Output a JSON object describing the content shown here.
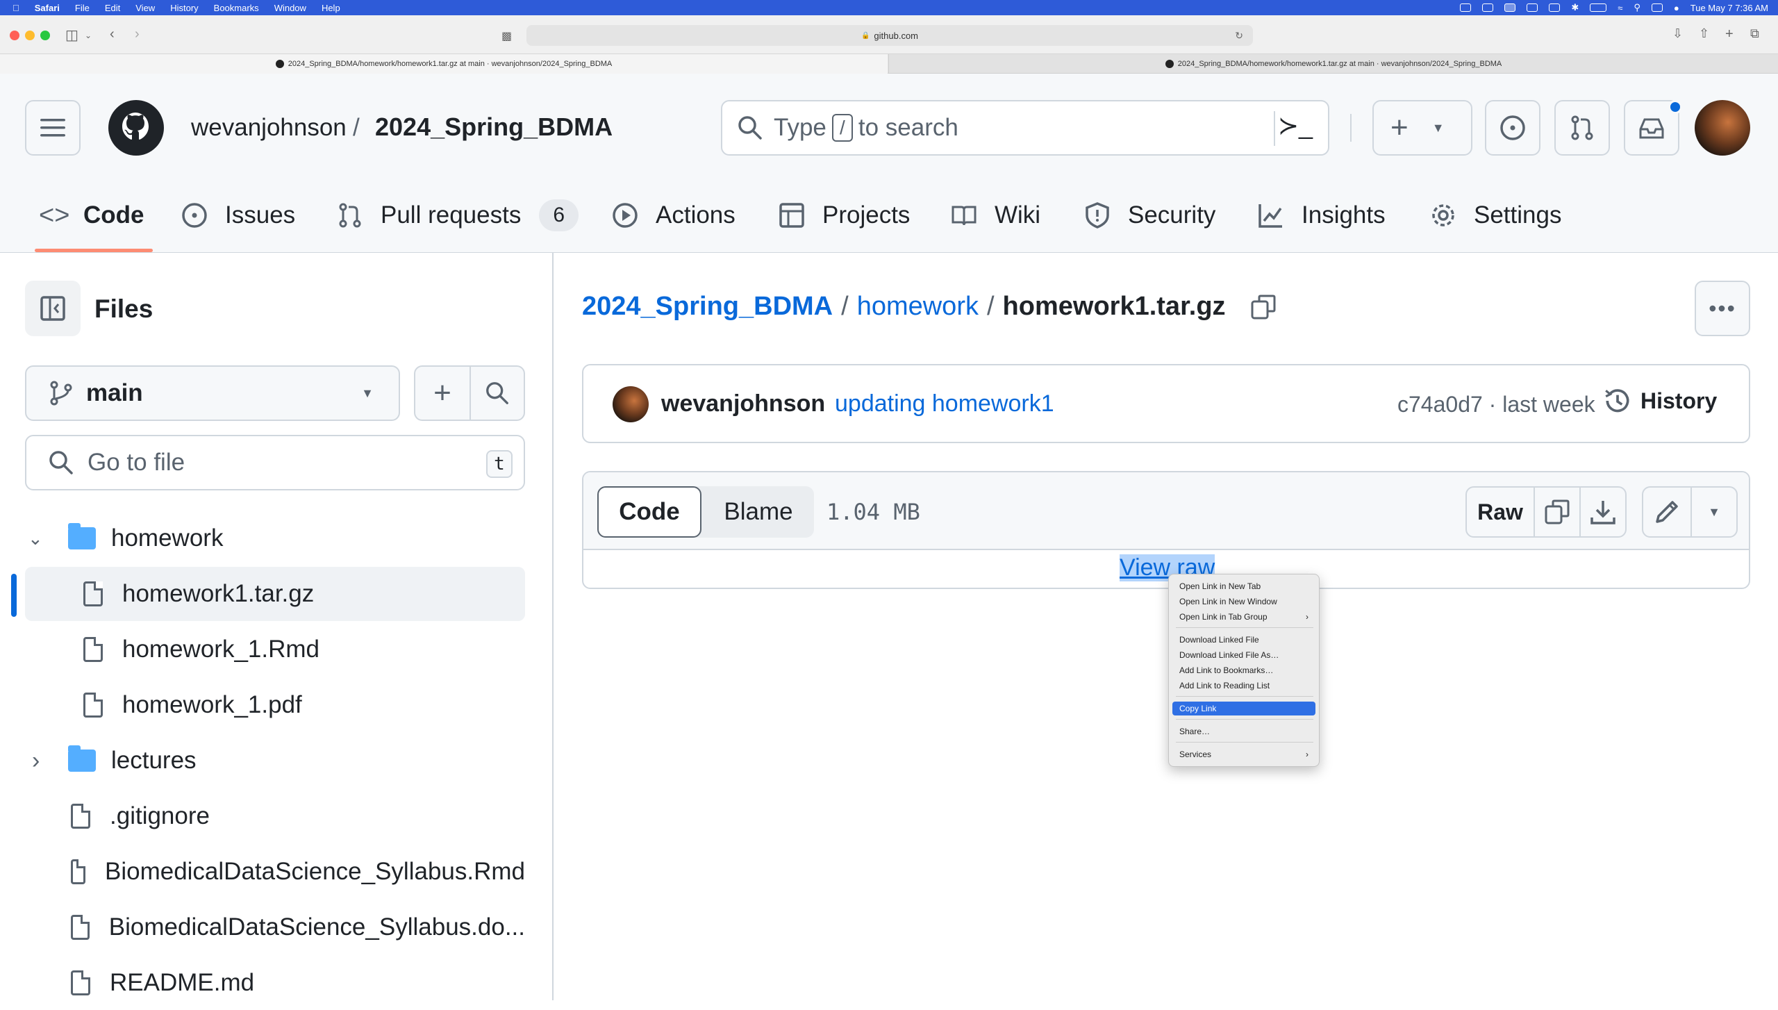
{
  "menubar": {
    "app": "Safari",
    "items": [
      "File",
      "Edit",
      "View",
      "History",
      "Bookmarks",
      "Window",
      "Help"
    ],
    "clock": "Tue May 7  7:36 AM"
  },
  "browser": {
    "url": "github.com",
    "tabs": [
      {
        "title": "2024_Spring_BDMA/homework/homework1.tar.gz at main · wevanjohnson/2024_Spring_BDMA"
      },
      {
        "title": "2024_Spring_BDMA/homework/homework1.tar.gz at main · wevanjohnson/2024_Spring_BDMA"
      }
    ]
  },
  "header": {
    "owner": "wevanjohnson",
    "sep": "/",
    "repo": "2024_Spring_BDMA",
    "search_type": "Type",
    "search_key": "/",
    "search_rest": "to search"
  },
  "nav": {
    "code": "Code",
    "issues": "Issues",
    "pulls": "Pull requests",
    "pulls_count": "6",
    "actions": "Actions",
    "projects": "Projects",
    "wiki": "Wiki",
    "security": "Security",
    "insights": "Insights",
    "settings": "Settings"
  },
  "sidebar": {
    "title": "Files",
    "branch": "main",
    "goto_placeholder": "Go to file",
    "goto_key": "t",
    "tree": [
      {
        "name": "homework",
        "type": "folder",
        "expanded": true
      },
      {
        "name": "homework1.tar.gz",
        "type": "file",
        "selected": true
      },
      {
        "name": "homework_1.Rmd",
        "type": "file"
      },
      {
        "name": "homework_1.pdf",
        "type": "file"
      },
      {
        "name": "lectures",
        "type": "folder",
        "expanded": false
      },
      {
        "name": ".gitignore",
        "type": "file"
      },
      {
        "name": "BiomedicalDataScience_Syllabus.Rmd",
        "type": "file"
      },
      {
        "name": "BiomedicalDataScience_Syllabus.do...",
        "type": "file"
      },
      {
        "name": "README.md",
        "type": "file"
      }
    ]
  },
  "main": {
    "crumb_repo": "2024_Spring_BDMA",
    "crumb_sep": "/",
    "crumb_dir": "homework",
    "crumb_file": "homework1.tar.gz",
    "commit_author": "wevanjohnson",
    "commit_message": "updating homework1",
    "commit_meta": "c74a0d7 · last week",
    "history": "History",
    "tab_code": "Code",
    "tab_blame": "Blame",
    "file_size": "1.04 MB",
    "raw": "Raw",
    "view_raw": "View raw"
  },
  "context_menu": {
    "items": [
      "Open Link in New Tab",
      "Open Link in New Window",
      "Open Link in Tab Group",
      "Download Linked File",
      "Download Linked File As…",
      "Add Link to Bookmarks…",
      "Add Link to Reading List",
      "Copy Link",
      "Share…",
      "Services"
    ],
    "highlighted": "Copy Link"
  },
  "colors": {
    "accent_link": "#0969da",
    "menubar": "#2e5bd8",
    "selected_indicator": "#0969da",
    "active_tab_underline": "#fd8c73",
    "notification_dot": "#0969da"
  }
}
